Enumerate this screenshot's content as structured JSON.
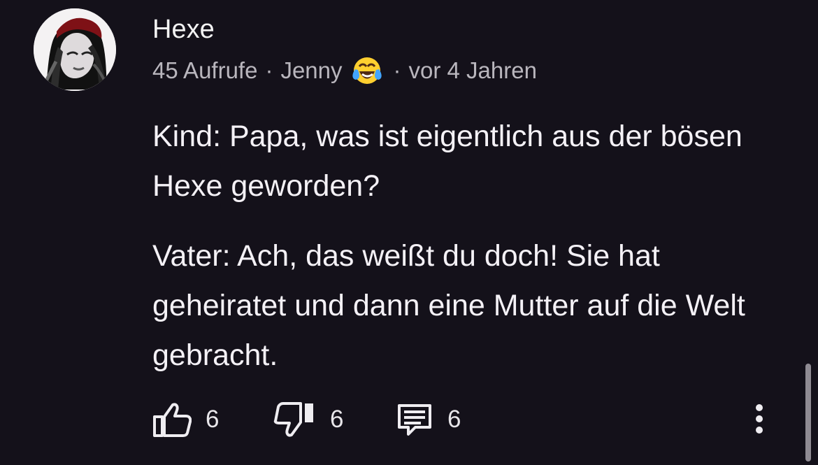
{
  "comment": {
    "author": "Hexe",
    "meta": {
      "views": "45 Aufrufe",
      "separator": "·",
      "user": "Jenny",
      "emoji": "tears-of-joy-emoji",
      "age": "vor 4 Jahren"
    },
    "paragraphs": [
      "Kind: Papa, was ist eigentlich aus der bösen Hexe geworden?",
      "Vater: Ach, das weißt du doch! Sie hat geheiratet und dann eine Mutter auf die Welt gebracht."
    ],
    "actions": {
      "likes": "6",
      "dislikes": "6",
      "replies": "6"
    }
  },
  "icons": {
    "like": "thumbs-up-icon",
    "dislike": "thumbs-down-icon",
    "reply": "reply-icon",
    "more": "more-vertical-icon"
  },
  "colors": {
    "background": "#14111a",
    "text": "#f4f1f6",
    "muted_text": "#b9b6bd",
    "avatar_hat": "#7e1116"
  }
}
